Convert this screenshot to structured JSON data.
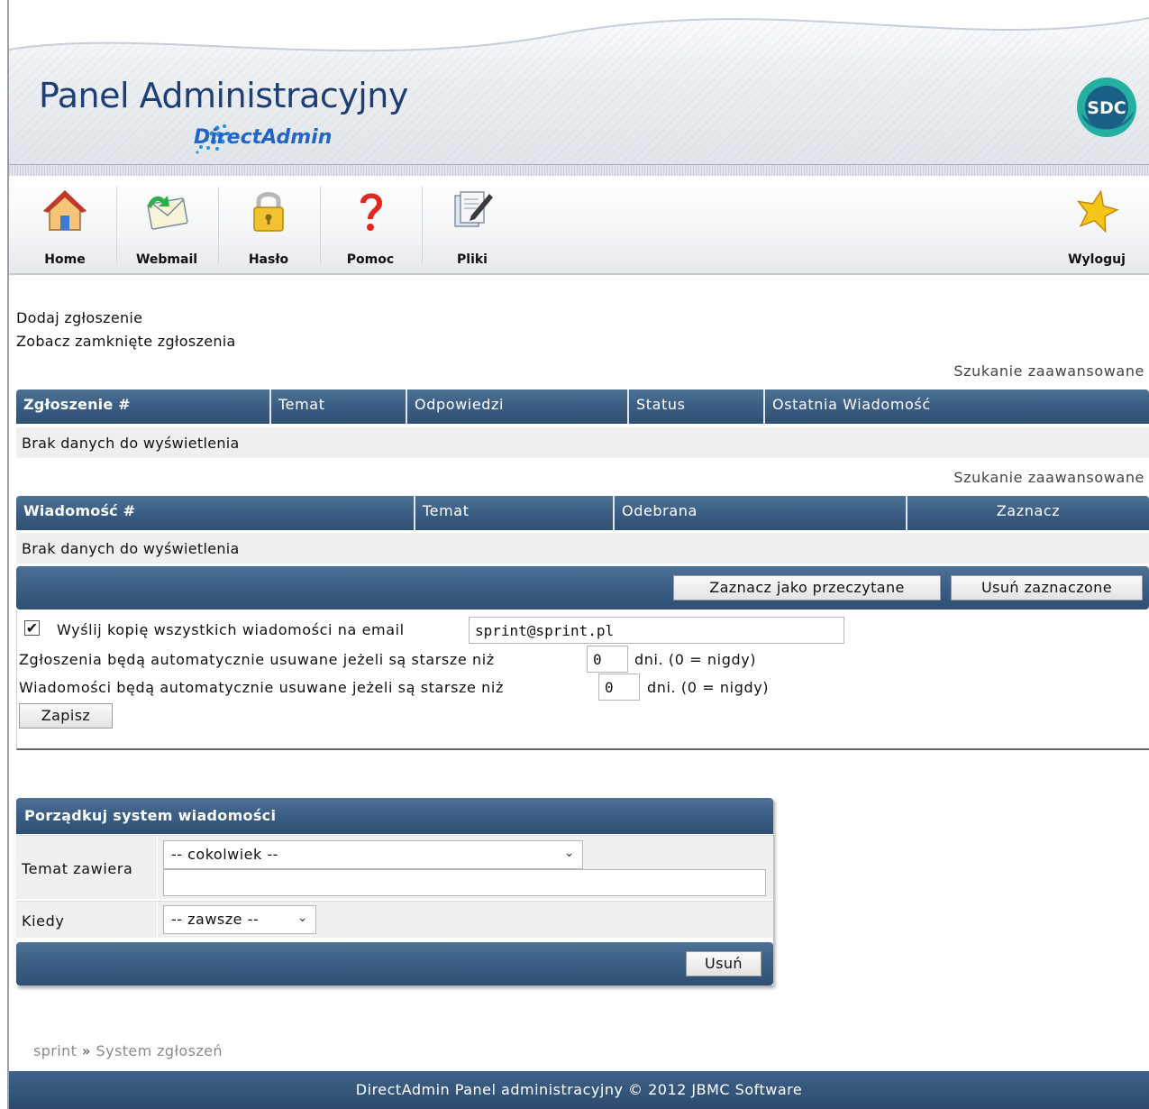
{
  "header": {
    "title": "Panel Administracyjny",
    "subtitle": "DirectAdmin",
    "logo_badge": "SDC"
  },
  "nav": {
    "items": [
      {
        "label": "Home",
        "icon": "home-icon"
      },
      {
        "label": "Webmail",
        "icon": "mail-icon"
      },
      {
        "label": "Hasło",
        "icon": "lock-icon"
      },
      {
        "label": "Pomoc",
        "icon": "help-icon"
      },
      {
        "label": "Pliki",
        "icon": "files-icon"
      }
    ],
    "logout": {
      "label": "Wyloguj",
      "icon": "star-icon"
    }
  },
  "links": {
    "add_ticket": "Dodaj zgłoszenie",
    "closed_tickets": "Zobacz zamknięte zgłoszenia",
    "advanced_search": "Szukanie zaawansowane"
  },
  "tickets_table": {
    "columns": [
      "Zgłoszenie #",
      "Temat",
      "Odpowiedzi",
      "Status",
      "Ostatnia Wiadomość"
    ],
    "empty_text": "Brak danych do wyświetlenia"
  },
  "messages_table": {
    "columns": [
      "Wiadomość #",
      "Temat",
      "Odebrana",
      "Zaznacz"
    ],
    "empty_text": "Brak danych do wyświetlenia",
    "mark_read_button": "Zaznacz jako przeczytane",
    "delete_selected_button": "Usuń zaznaczone"
  },
  "settings": {
    "copy_label": "Wyślij kopię wszystkich wiadomości na email",
    "copy_checked": true,
    "email_value": "sprint@sprint.pl",
    "tickets_delete_label": "Zgłoszenia będą automatycznie usuwane jeżeli są starsze niż",
    "tickets_days": "0",
    "messages_delete_label": "Wiadomości będą automatycznie usuwane jeżeli są starsze niż",
    "messages_days": "0",
    "days_suffix": "dni. (0 = nigdy)",
    "save_button": "Zapisz"
  },
  "cleanup": {
    "title": "Porządkuj system wiadomości",
    "subject_label": "Temat zawiera",
    "subject_select": "-- cokolwiek --",
    "subject_text": "",
    "when_label": "Kiedy",
    "when_select": "-- zawsze --",
    "delete_button": "Usuń"
  },
  "breadcrumb": {
    "user": "sprint",
    "separator": "»",
    "page": "System zgłoszeń"
  },
  "footer": {
    "text": "DirectAdmin Panel administracyjny © 2012 JBMC Software"
  }
}
